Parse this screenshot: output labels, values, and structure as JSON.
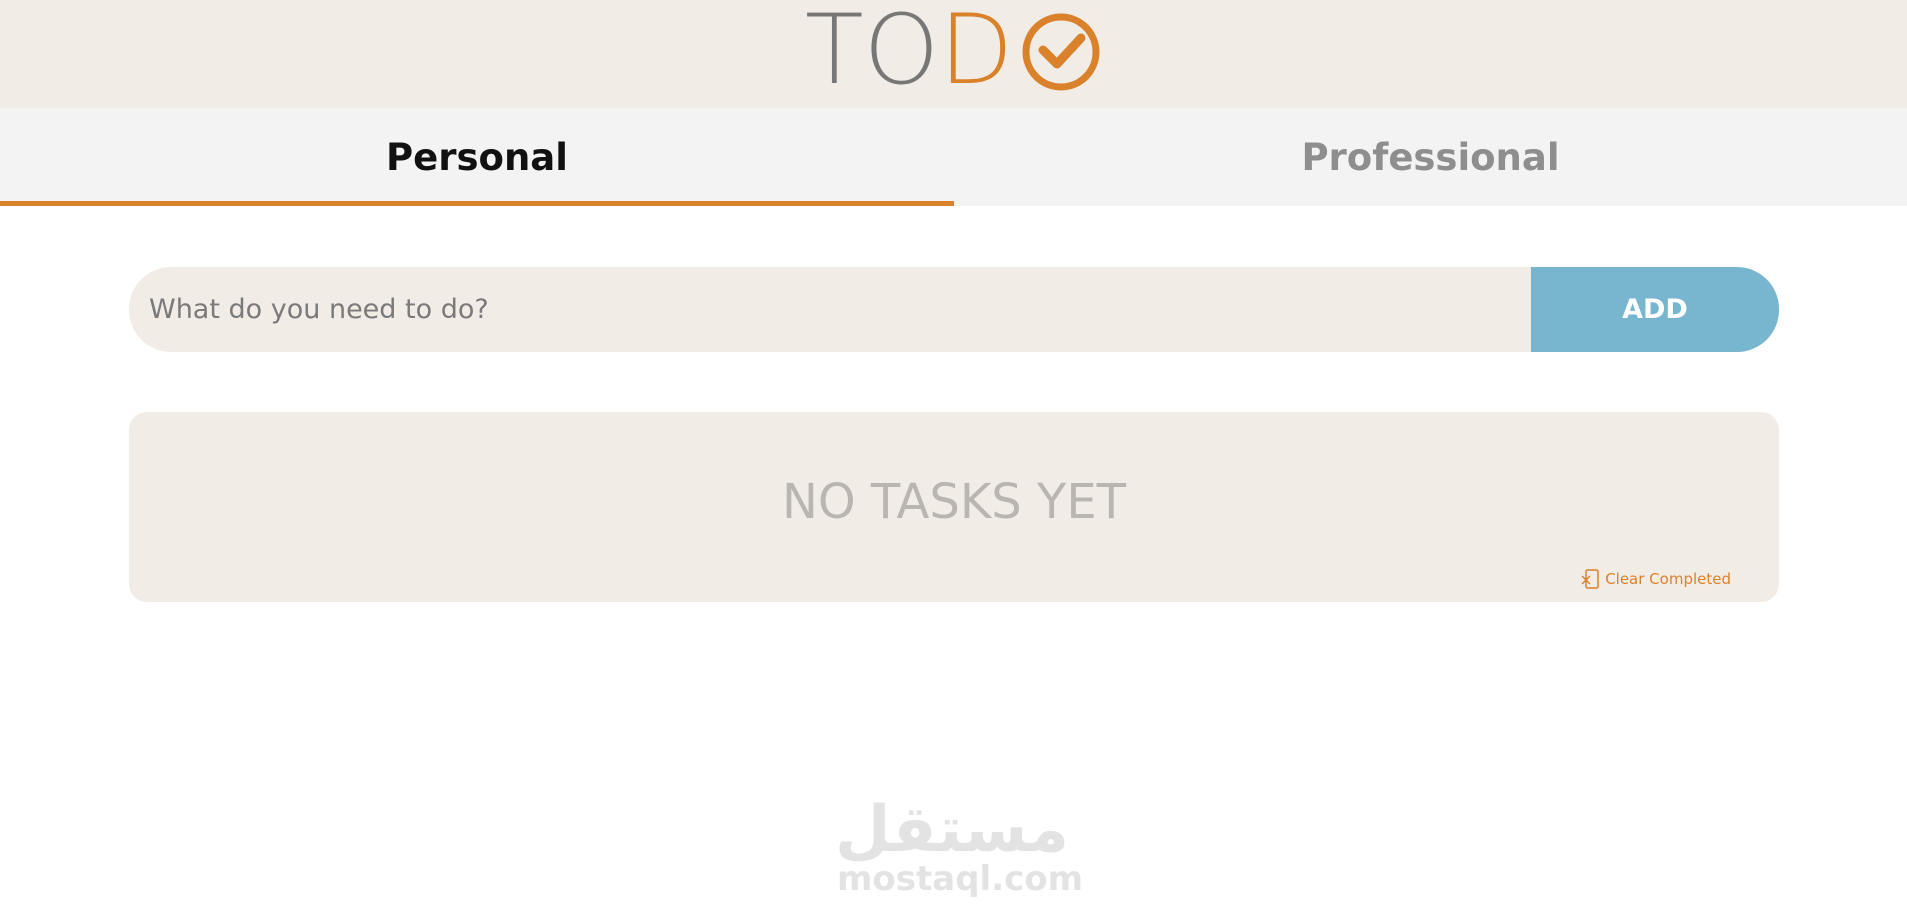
{
  "header": {
    "logo": {
      "letters": [
        "T",
        "O",
        "D"
      ],
      "letter_colors": [
        "#777777",
        "#777777",
        "#d9822b"
      ],
      "check_icon": "check-circle-icon",
      "accent": "#d9822b"
    }
  },
  "tabs": [
    {
      "label": "Personal",
      "active": true
    },
    {
      "label": "Professional",
      "active": false
    }
  ],
  "task_form": {
    "placeholder": "What do you need to do?",
    "value": "",
    "add_label": "ADD",
    "add_color": "#78b6cf"
  },
  "tasks": {
    "empty_message": "NO TASKS YET",
    "clear_completed_label": "Clear Completed",
    "clear_icon": "clear-list-icon"
  },
  "watermark": {
    "arabic": "مستقل",
    "latin": "mostaql.com"
  },
  "colors": {
    "header_bg": "#f1ece6",
    "tab_bar_bg": "#f3f3f3",
    "accent": "#d9822b",
    "add_button": "#78b6cf",
    "muted_text": "#b9b6b2"
  }
}
